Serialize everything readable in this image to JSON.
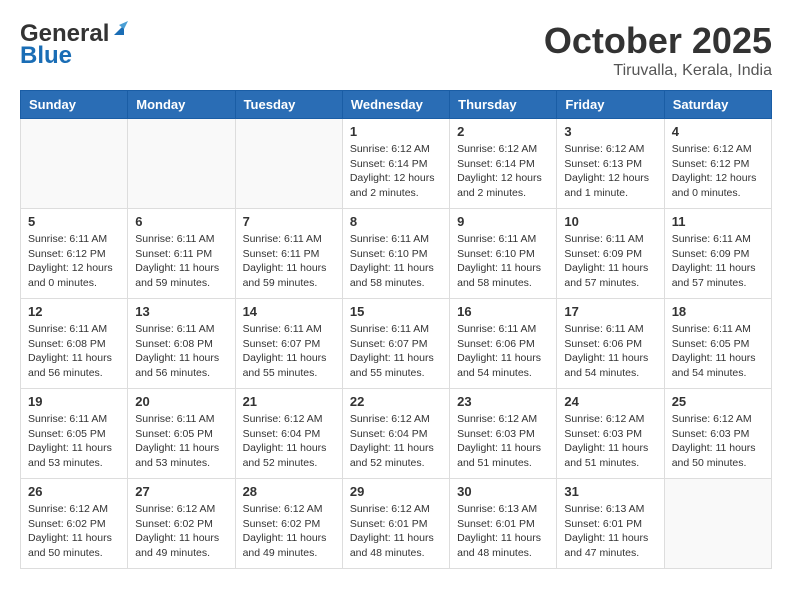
{
  "header": {
    "logo_line1": "General",
    "logo_line2": "Blue",
    "month": "October 2025",
    "location": "Tiruvalla, Kerala, India"
  },
  "weekdays": [
    "Sunday",
    "Monday",
    "Tuesday",
    "Wednesday",
    "Thursday",
    "Friday",
    "Saturday"
  ],
  "weeks": [
    [
      {
        "day": "",
        "info": ""
      },
      {
        "day": "",
        "info": ""
      },
      {
        "day": "",
        "info": ""
      },
      {
        "day": "1",
        "info": "Sunrise: 6:12 AM\nSunset: 6:14 PM\nDaylight: 12 hours and 2 minutes."
      },
      {
        "day": "2",
        "info": "Sunrise: 6:12 AM\nSunset: 6:14 PM\nDaylight: 12 hours and 2 minutes."
      },
      {
        "day": "3",
        "info": "Sunrise: 6:12 AM\nSunset: 6:13 PM\nDaylight: 12 hours and 1 minute."
      },
      {
        "day": "4",
        "info": "Sunrise: 6:12 AM\nSunset: 6:12 PM\nDaylight: 12 hours and 0 minutes."
      }
    ],
    [
      {
        "day": "5",
        "info": "Sunrise: 6:11 AM\nSunset: 6:12 PM\nDaylight: 12 hours and 0 minutes."
      },
      {
        "day": "6",
        "info": "Sunrise: 6:11 AM\nSunset: 6:11 PM\nDaylight: 11 hours and 59 minutes."
      },
      {
        "day": "7",
        "info": "Sunrise: 6:11 AM\nSunset: 6:11 PM\nDaylight: 11 hours and 59 minutes."
      },
      {
        "day": "8",
        "info": "Sunrise: 6:11 AM\nSunset: 6:10 PM\nDaylight: 11 hours and 58 minutes."
      },
      {
        "day": "9",
        "info": "Sunrise: 6:11 AM\nSunset: 6:10 PM\nDaylight: 11 hours and 58 minutes."
      },
      {
        "day": "10",
        "info": "Sunrise: 6:11 AM\nSunset: 6:09 PM\nDaylight: 11 hours and 57 minutes."
      },
      {
        "day": "11",
        "info": "Sunrise: 6:11 AM\nSunset: 6:09 PM\nDaylight: 11 hours and 57 minutes."
      }
    ],
    [
      {
        "day": "12",
        "info": "Sunrise: 6:11 AM\nSunset: 6:08 PM\nDaylight: 11 hours and 56 minutes."
      },
      {
        "day": "13",
        "info": "Sunrise: 6:11 AM\nSunset: 6:08 PM\nDaylight: 11 hours and 56 minutes."
      },
      {
        "day": "14",
        "info": "Sunrise: 6:11 AM\nSunset: 6:07 PM\nDaylight: 11 hours and 55 minutes."
      },
      {
        "day": "15",
        "info": "Sunrise: 6:11 AM\nSunset: 6:07 PM\nDaylight: 11 hours and 55 minutes."
      },
      {
        "day": "16",
        "info": "Sunrise: 6:11 AM\nSunset: 6:06 PM\nDaylight: 11 hours and 54 minutes."
      },
      {
        "day": "17",
        "info": "Sunrise: 6:11 AM\nSunset: 6:06 PM\nDaylight: 11 hours and 54 minutes."
      },
      {
        "day": "18",
        "info": "Sunrise: 6:11 AM\nSunset: 6:05 PM\nDaylight: 11 hours and 54 minutes."
      }
    ],
    [
      {
        "day": "19",
        "info": "Sunrise: 6:11 AM\nSunset: 6:05 PM\nDaylight: 11 hours and 53 minutes."
      },
      {
        "day": "20",
        "info": "Sunrise: 6:11 AM\nSunset: 6:05 PM\nDaylight: 11 hours and 53 minutes."
      },
      {
        "day": "21",
        "info": "Sunrise: 6:12 AM\nSunset: 6:04 PM\nDaylight: 11 hours and 52 minutes."
      },
      {
        "day": "22",
        "info": "Sunrise: 6:12 AM\nSunset: 6:04 PM\nDaylight: 11 hours and 52 minutes."
      },
      {
        "day": "23",
        "info": "Sunrise: 6:12 AM\nSunset: 6:03 PM\nDaylight: 11 hours and 51 minutes."
      },
      {
        "day": "24",
        "info": "Sunrise: 6:12 AM\nSunset: 6:03 PM\nDaylight: 11 hours and 51 minutes."
      },
      {
        "day": "25",
        "info": "Sunrise: 6:12 AM\nSunset: 6:03 PM\nDaylight: 11 hours and 50 minutes."
      }
    ],
    [
      {
        "day": "26",
        "info": "Sunrise: 6:12 AM\nSunset: 6:02 PM\nDaylight: 11 hours and 50 minutes."
      },
      {
        "day": "27",
        "info": "Sunrise: 6:12 AM\nSunset: 6:02 PM\nDaylight: 11 hours and 49 minutes."
      },
      {
        "day": "28",
        "info": "Sunrise: 6:12 AM\nSunset: 6:02 PM\nDaylight: 11 hours and 49 minutes."
      },
      {
        "day": "29",
        "info": "Sunrise: 6:12 AM\nSunset: 6:01 PM\nDaylight: 11 hours and 48 minutes."
      },
      {
        "day": "30",
        "info": "Sunrise: 6:13 AM\nSunset: 6:01 PM\nDaylight: 11 hours and 48 minutes."
      },
      {
        "day": "31",
        "info": "Sunrise: 6:13 AM\nSunset: 6:01 PM\nDaylight: 11 hours and 47 minutes."
      },
      {
        "day": "",
        "info": ""
      }
    ]
  ]
}
